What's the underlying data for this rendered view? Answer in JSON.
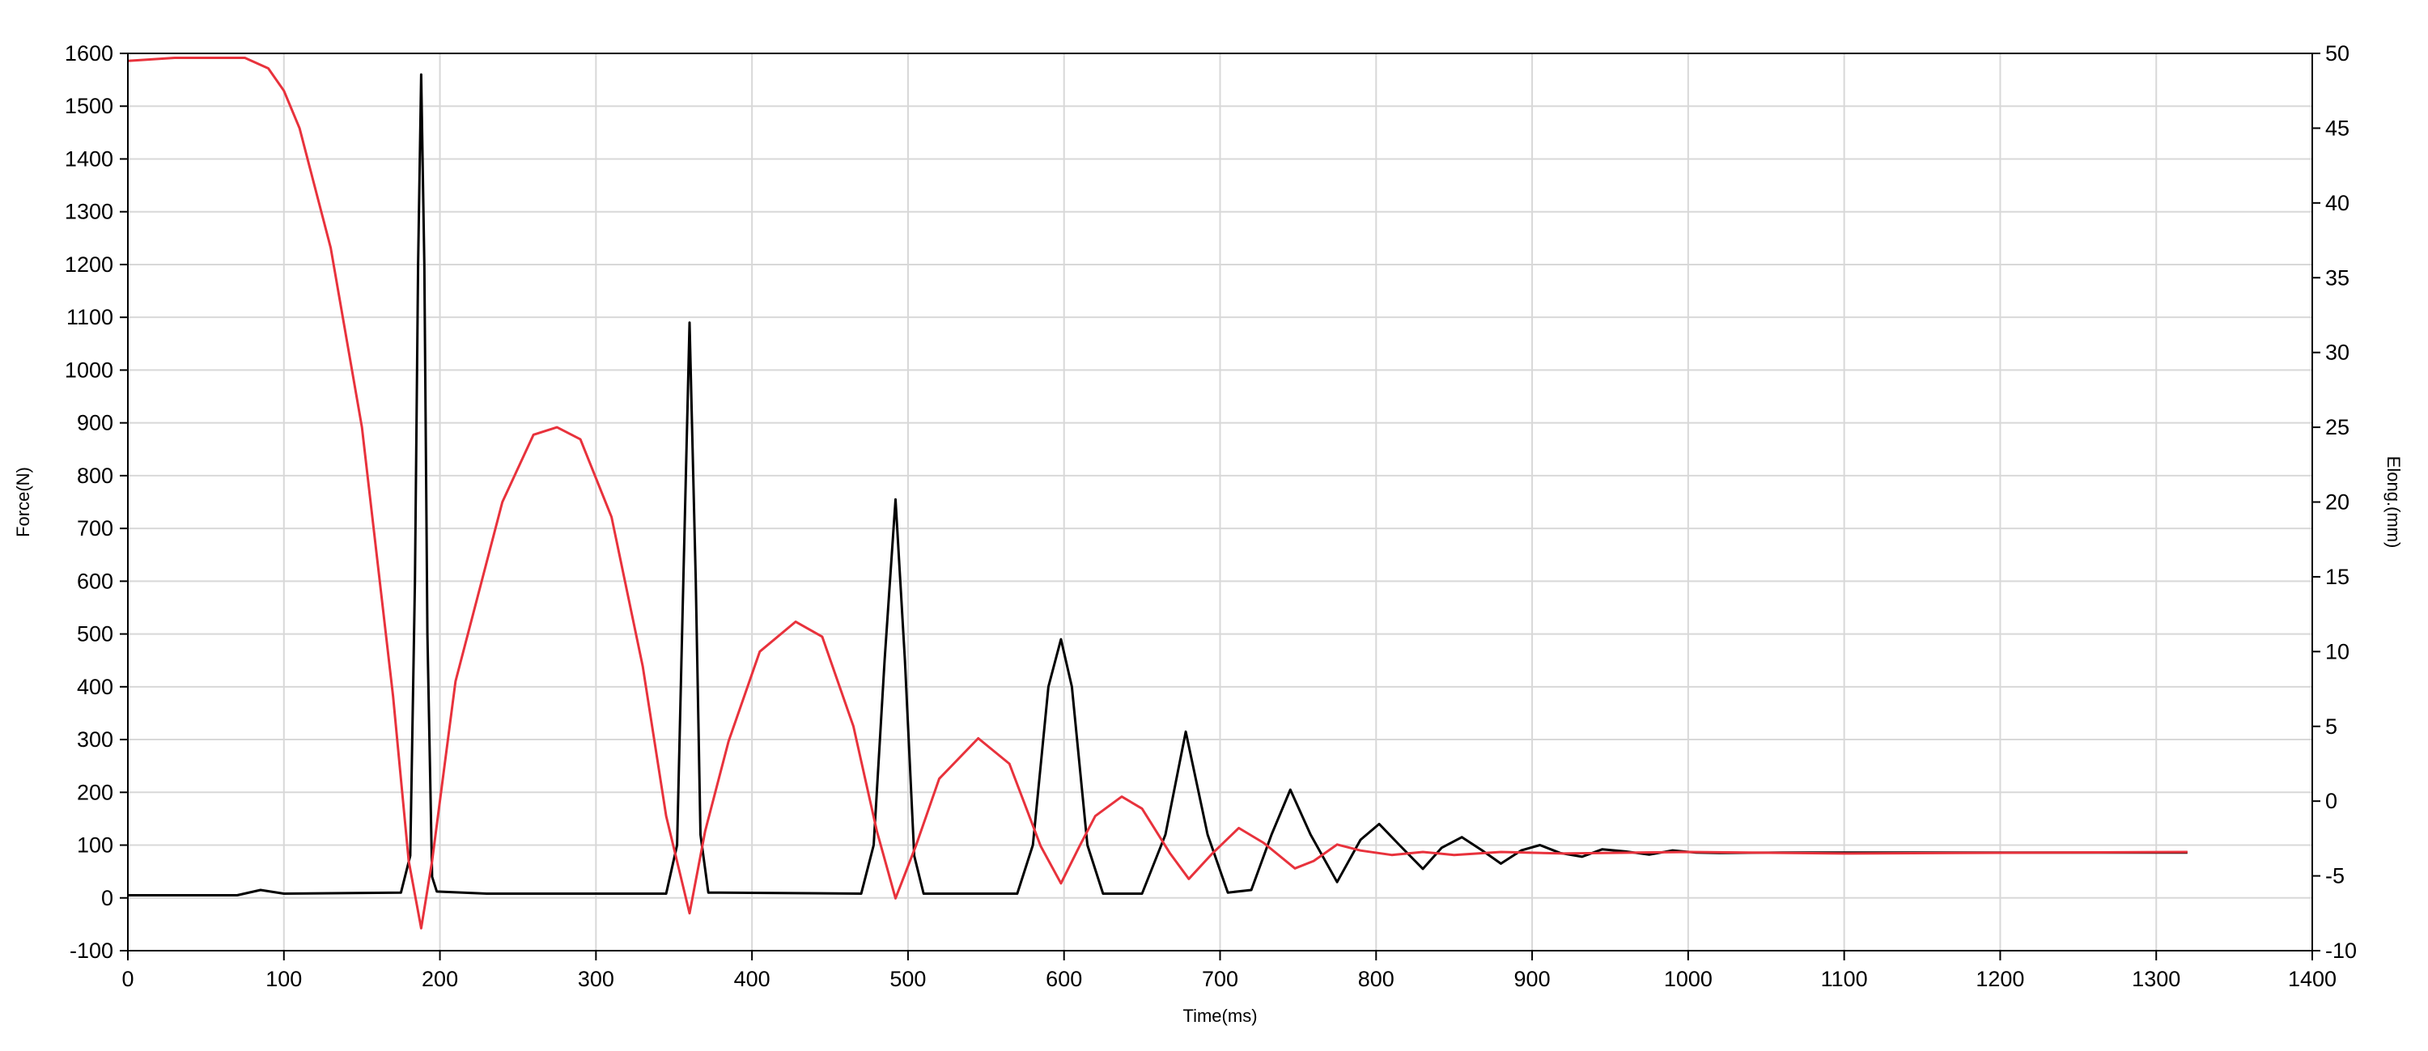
{
  "chart_data": {
    "type": "line",
    "title": "",
    "xlabel": "Time(ms)",
    "ylabel": "Force(N)",
    "y2label": "Elong.(mm)",
    "xlim": [
      0,
      1400
    ],
    "ylim": [
      -100,
      1600
    ],
    "y2lim": [
      -10,
      50
    ],
    "x_ticks": [
      "0",
      "100",
      "200",
      "300",
      "400",
      "500",
      "600",
      "700",
      "800",
      "900",
      "1000",
      "1100",
      "1200",
      "1300",
      "1400"
    ],
    "y_ticks": [
      "-100",
      "0",
      "100",
      "200",
      "300",
      "400",
      "500",
      "600",
      "700",
      "800",
      "900",
      "1000",
      "1100",
      "1200",
      "1300",
      "1400",
      "1500",
      "1600"
    ],
    "y2_ticks": [
      "-10",
      "-5",
      "0",
      "5",
      "10",
      "15",
      "20",
      "25",
      "30",
      "35",
      "40",
      "45",
      "50"
    ],
    "grid": true,
    "legend": "none",
    "series": [
      {
        "axis": "left",
        "color": "#000000",
        "points": [
          [
            0,
            5
          ],
          [
            70,
            5
          ],
          [
            85,
            15
          ],
          [
            100,
            8
          ],
          [
            175,
            10
          ],
          [
            181,
            80
          ],
          [
            184,
            600
          ],
          [
            186,
            1200
          ],
          [
            188,
            1560
          ],
          [
            190,
            1200
          ],
          [
            192,
            500
          ],
          [
            195,
            40
          ],
          [
            198,
            12
          ],
          [
            230,
            8
          ],
          [
            345,
            8
          ],
          [
            352,
            100
          ],
          [
            356,
            600
          ],
          [
            360,
            1090
          ],
          [
            364,
            600
          ],
          [
            367,
            120
          ],
          [
            372,
            10
          ],
          [
            470,
            8
          ],
          [
            478,
            100
          ],
          [
            485,
            450
          ],
          [
            492,
            755
          ],
          [
            498,
            450
          ],
          [
            504,
            80
          ],
          [
            510,
            8
          ],
          [
            570,
            8
          ],
          [
            580,
            100
          ],
          [
            590,
            400
          ],
          [
            598,
            490
          ],
          [
            605,
            400
          ],
          [
            615,
            100
          ],
          [
            625,
            8
          ],
          [
            650,
            8
          ],
          [
            665,
            120
          ],
          [
            678,
            315
          ],
          [
            692,
            120
          ],
          [
            705,
            10
          ],
          [
            720,
            15
          ],
          [
            733,
            120
          ],
          [
            745,
            205
          ],
          [
            758,
            120
          ],
          [
            775,
            30
          ],
          [
            790,
            110
          ],
          [
            802,
            140
          ],
          [
            815,
            100
          ],
          [
            830,
            55
          ],
          [
            842,
            95
          ],
          [
            855,
            115
          ],
          [
            868,
            90
          ],
          [
            880,
            65
          ],
          [
            893,
            90
          ],
          [
            905,
            100
          ],
          [
            918,
            85
          ],
          [
            932,
            78
          ],
          [
            945,
            92
          ],
          [
            960,
            88
          ],
          [
            975,
            82
          ],
          [
            990,
            90
          ],
          [
            1005,
            86
          ],
          [
            1020,
            85
          ],
          [
            1060,
            86
          ],
          [
            1150,
            86
          ],
          [
            1250,
            86
          ],
          [
            1320,
            86
          ]
        ]
      },
      {
        "axis": "right",
        "color": "#e8323c",
        "points": [
          [
            0,
            49.5
          ],
          [
            30,
            49.7
          ],
          [
            75,
            49.7
          ],
          [
            90,
            49.0
          ],
          [
            100,
            47.5
          ],
          [
            110,
            45
          ],
          [
            130,
            37
          ],
          [
            150,
            25
          ],
          [
            170,
            7
          ],
          [
            180,
            -4
          ],
          [
            188,
            -8.5
          ],
          [
            195,
            -4
          ],
          [
            210,
            8
          ],
          [
            240,
            20
          ],
          [
            260,
            24.5
          ],
          [
            275,
            25
          ],
          [
            290,
            24.2
          ],
          [
            310,
            19
          ],
          [
            330,
            9
          ],
          [
            345,
            -1
          ],
          [
            360,
            -7.5
          ],
          [
            370,
            -2
          ],
          [
            385,
            4
          ],
          [
            405,
            10
          ],
          [
            428,
            12
          ],
          [
            445,
            11
          ],
          [
            465,
            5
          ],
          [
            480,
            -2
          ],
          [
            492,
            -6.5
          ],
          [
            505,
            -3
          ],
          [
            520,
            1.5
          ],
          [
            545,
            4.2
          ],
          [
            565,
            2.5
          ],
          [
            585,
            -3
          ],
          [
            598,
            -5.5
          ],
          [
            610,
            -3
          ],
          [
            620,
            -1
          ],
          [
            637,
            0.3
          ],
          [
            650,
            -0.5
          ],
          [
            668,
            -3.5
          ],
          [
            680,
            -5.2
          ],
          [
            695,
            -3.5
          ],
          [
            712,
            -1.8
          ],
          [
            728,
            -2.8
          ],
          [
            748,
            -4.5
          ],
          [
            760,
            -4
          ],
          [
            775,
            -2.9
          ],
          [
            790,
            -3.3
          ],
          [
            810,
            -3.6
          ],
          [
            830,
            -3.4
          ],
          [
            850,
            -3.6
          ],
          [
            880,
            -3.4
          ],
          [
            920,
            -3.5
          ],
          [
            1000,
            -3.4
          ],
          [
            1100,
            -3.5
          ],
          [
            1320,
            -3.4
          ]
        ]
      }
    ]
  }
}
